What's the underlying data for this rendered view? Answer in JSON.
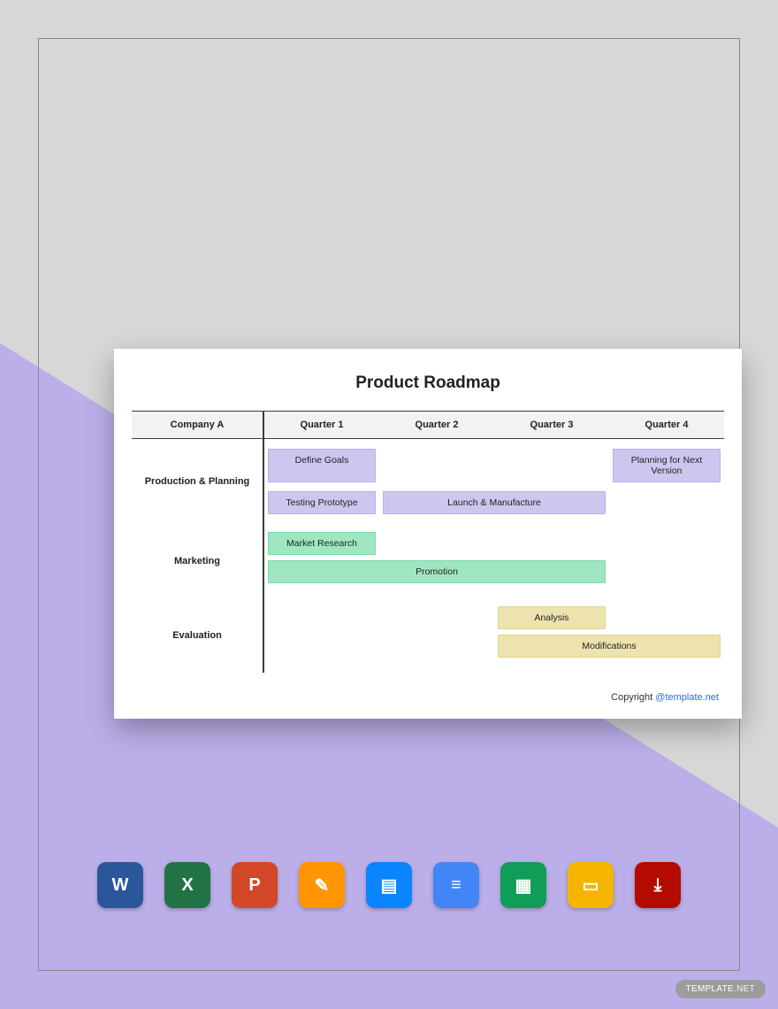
{
  "title": "Product Roadmap",
  "company": "Company A",
  "quarters": [
    "Quarter 1",
    "Quarter 2",
    "Quarter 3",
    "Quarter 4"
  ],
  "rows": [
    {
      "label": "Production & Planning",
      "color": "lavender",
      "bars": [
        {
          "text": "Define Goals",
          "start": 0,
          "span": 1
        },
        {
          "text": "Testing Prototype",
          "start": 0,
          "span": 1
        },
        {
          "text": "Launch & Manufacture",
          "start": 1,
          "span": 2
        },
        {
          "text": "Planning for Next Version",
          "start": 3,
          "span": 1
        }
      ]
    },
    {
      "label": "Marketing",
      "color": "mint",
      "bars": [
        {
          "text": "Market Research",
          "start": 0,
          "span": 1
        },
        {
          "text": "Promotion",
          "start": 0,
          "span": 3
        }
      ]
    },
    {
      "label": "Evaluation",
      "color": "sand",
      "bars": [
        {
          "text": "Analysis",
          "start": 2,
          "span": 1
        },
        {
          "text": "Modifications",
          "start": 2,
          "span": 2
        }
      ]
    }
  ],
  "copyright": {
    "prefix": "Copyright ",
    "link": "@template.net"
  },
  "icons": [
    {
      "name": "word-icon",
      "glyph": "W",
      "cls": "ic-word"
    },
    {
      "name": "excel-icon",
      "glyph": "X",
      "cls": "ic-excel"
    },
    {
      "name": "powerpoint-icon",
      "glyph": "P",
      "cls": "ic-ppt"
    },
    {
      "name": "pages-icon",
      "glyph": "✎",
      "cls": "ic-pages"
    },
    {
      "name": "keynote-icon",
      "glyph": "▤",
      "cls": "ic-key"
    },
    {
      "name": "google-docs-icon",
      "glyph": "≡",
      "cls": "ic-docs"
    },
    {
      "name": "google-sheets-icon",
      "glyph": "▦",
      "cls": "ic-sheets"
    },
    {
      "name": "google-slides-icon",
      "glyph": "▭",
      "cls": "ic-slides"
    },
    {
      "name": "pdf-icon",
      "glyph": "⤓",
      "cls": "ic-pdf"
    }
  ],
  "badge": {
    "a": "TEMPLATE",
    "b": ".NET"
  }
}
